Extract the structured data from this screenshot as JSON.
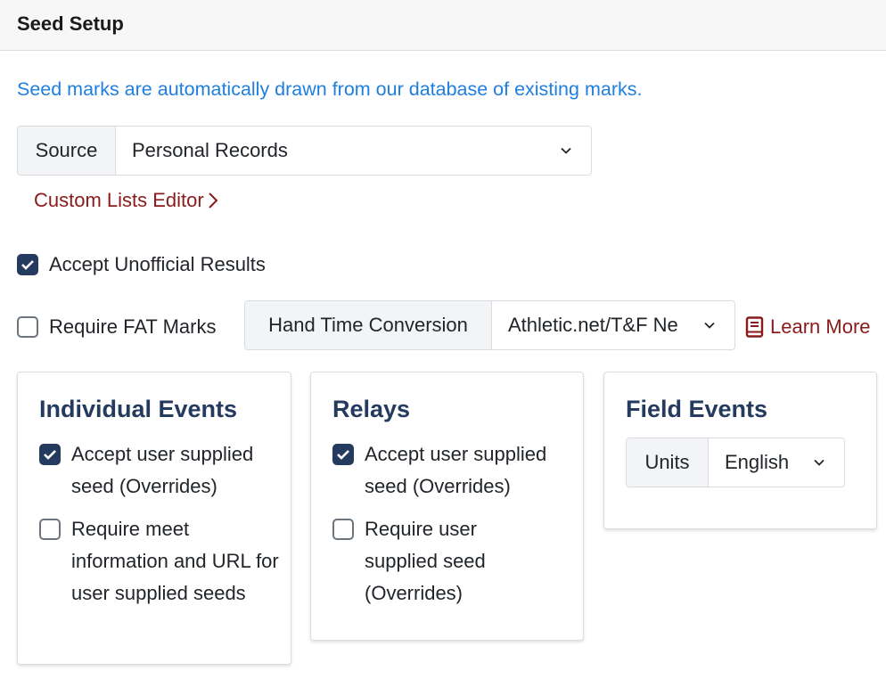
{
  "header": {
    "title": "Seed Setup"
  },
  "info_text": "Seed marks are automatically drawn from our database of existing marks.",
  "source": {
    "label": "Source",
    "value": "Personal Records"
  },
  "custom_lists_link": "Custom Lists Editor",
  "accept_unofficial": {
    "label": "Accept Unofficial Results",
    "checked": true
  },
  "require_fat": {
    "label": "Require FAT Marks",
    "checked": false
  },
  "hand_time": {
    "label": "Hand Time Conversion",
    "value": "Athletic.net/T&F Ne"
  },
  "learn_more": "Learn More",
  "individual_events": {
    "title": "Individual Events",
    "accept_user_seed": {
      "label": "Accept user supplied seed (Overrides)",
      "checked": true
    },
    "require_meet_info": {
      "label": "Require meet information and URL for user supplied seeds",
      "checked": false
    }
  },
  "relays": {
    "title": "Relays",
    "accept_user_seed": {
      "label": "Accept user supplied seed (Overrides)",
      "checked": true
    },
    "require_user_seed": {
      "label": "Require user supplied seed (Overrides)",
      "checked": false
    }
  },
  "field_events": {
    "title": "Field Events",
    "units": {
      "label": "Units",
      "value": "English"
    }
  },
  "colors": {
    "link_blue": "#1e7fe0",
    "link_red": "#8b1a1a",
    "heading_navy": "#243a5e",
    "checkbox_checked": "#243a5e"
  }
}
